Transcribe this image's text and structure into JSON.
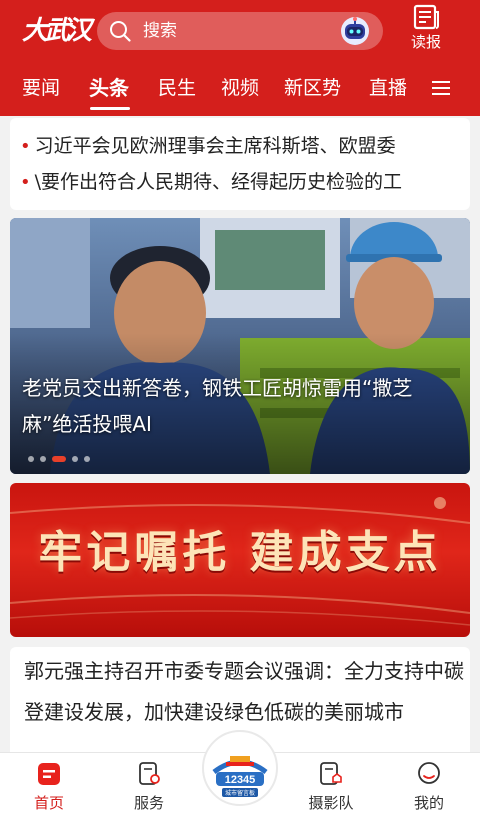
{
  "header": {
    "logo_text": "大武汉",
    "search_placeholder": "搜索",
    "read_label": "读报",
    "tabs": [
      "要闻",
      "头条",
      "民生",
      "视频",
      "新区势",
      "直播"
    ],
    "active_tab": "头条"
  },
  "news_lines": [
    "习近平会见欧洲理事会主席科斯塔、欧盟委",
    "\\要作出符合人民期待、经得起历史检验的工"
  ],
  "hero": {
    "caption": "老党员交出新答卷，钢铁工匠胡惊雷用“撒芝麻”绝活投喂AI",
    "slide_count": 5,
    "active_slide": 3
  },
  "banner": {
    "text": "牢记嘱托 建成支点"
  },
  "article": {
    "title": "郭元强主持召开市委专题会议强调：全力支持中碳登建设发展，加快建设绿色低碳的美丽城市"
  },
  "bottom_nav": {
    "items": [
      "首页",
      "服务",
      "摄影队",
      "我的"
    ],
    "center_badge_text": "12345",
    "center_badge_sub": "城市留言板"
  },
  "colors": {
    "brand_red": "#d41f1c",
    "banner_text": "#fde4b8"
  }
}
